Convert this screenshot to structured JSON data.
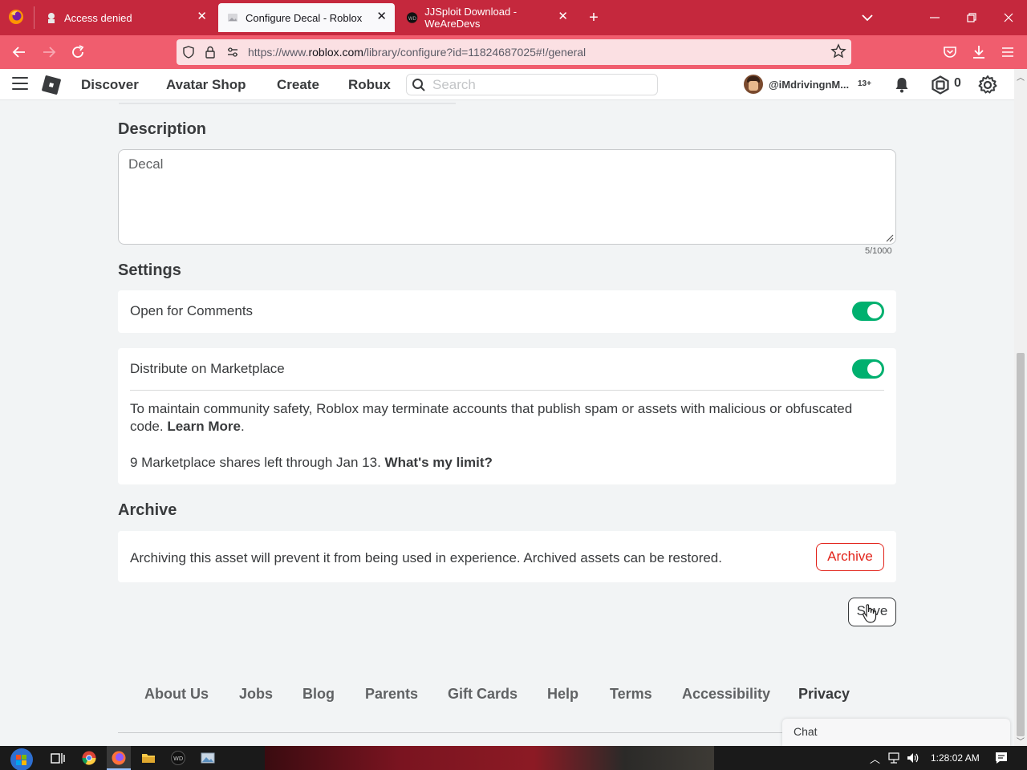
{
  "browser": {
    "tabs": [
      {
        "title": "Access denied",
        "close": "✕"
      },
      {
        "title": "Configure Decal - Roblox",
        "close": "✕"
      },
      {
        "title": "JJSploit Download - WeAreDevs",
        "close": "✕"
      }
    ],
    "new_tab": "+",
    "url_prefix": "https://www.",
    "url_host": "roblox.com",
    "url_path": "/library/configure?id=11824687025#!/general"
  },
  "header": {
    "nav": [
      "Discover",
      "Avatar Shop",
      "Create",
      "Robux"
    ],
    "search_placeholder": "Search",
    "username": "@iMdrivingnM...",
    "age_badge": "13+",
    "robux": "0"
  },
  "description": {
    "title": "Description",
    "value": "Decal",
    "char_count": "5/1000"
  },
  "settings": {
    "title": "Settings",
    "comments_label": "Open for Comments",
    "comments_on": true,
    "marketplace_label": "Distribute on Marketplace",
    "marketplace_on": true,
    "safety_text": "To maintain community safety, Roblox may terminate accounts that publish spam or assets with malicious or obfuscated code.",
    "learn_more": "Learn More",
    "period": ".",
    "shares_text": "9 Marketplace shares left through Jan 13.",
    "limit_link": "What's my limit?"
  },
  "archive": {
    "title": "Archive",
    "text": "Archiving this asset will prevent it from being used in experience. Archived assets can be restored.",
    "button": "Archive"
  },
  "save_label": "Save",
  "footer": {
    "links": [
      "About Us",
      "Jobs",
      "Blog",
      "Parents",
      "Gift Cards",
      "Help",
      "Terms",
      "Accessibility",
      "Privacy"
    ]
  },
  "chat": {
    "label": "Chat"
  },
  "taskbar": {
    "clock": "1:28:02 AM"
  },
  "colors": {
    "tabbar": "#c5283d",
    "navbar": "#f05d6e",
    "toggle_on": "#00b06f",
    "archive_red": "#e2231a"
  }
}
